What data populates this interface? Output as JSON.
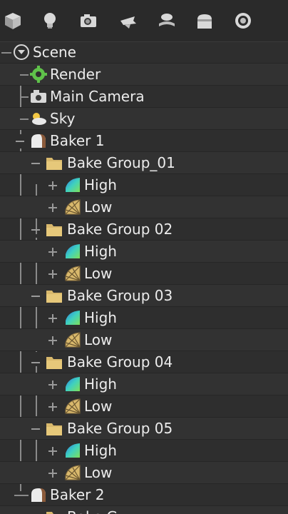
{
  "toolbar": {
    "buttons": [
      {
        "icon": "cube-icon"
      },
      {
        "icon": "light-bulb-icon"
      },
      {
        "icon": "camera-icon"
      },
      {
        "icon": "sky-icon"
      },
      {
        "icon": "mesh-icon"
      },
      {
        "icon": "baker-icon"
      },
      {
        "icon": "audio-icon"
      }
    ]
  },
  "tree": {
    "scene": "Scene",
    "render": "Render",
    "main_camera": "Main Camera",
    "sky": "Sky",
    "baker1": "Baker 1",
    "groups": [
      {
        "label": "Bake Group_01",
        "high": "High",
        "low": "Low"
      },
      {
        "label": "Bake Group 02",
        "high": "High",
        "low": "Low"
      },
      {
        "label": "Bake Group 03",
        "high": "High",
        "low": "Low"
      },
      {
        "label": "Bake Group 04",
        "high": "High",
        "low": "Low"
      },
      {
        "label": "Bake Group 05",
        "high": "High",
        "low": "Low"
      }
    ],
    "baker2": "Baker 2",
    "baker2_child": "Bake G"
  },
  "colors": {
    "background": "#2e2e2e",
    "text": "#ececec",
    "folder": "#d8b86c",
    "render_gear": "#5fc24a"
  }
}
